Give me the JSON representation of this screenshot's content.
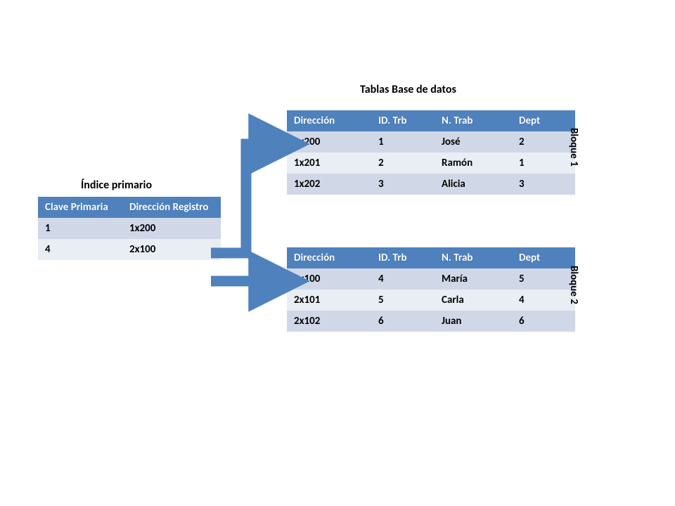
{
  "titles": {
    "tablas": "Tablas Base de datos",
    "indice": "Índice primario"
  },
  "index": {
    "headers": [
      "Clave Primaria",
      "Dirección Registro"
    ],
    "rows": [
      {
        "clave": "1",
        "dir": "1x200"
      },
      {
        "clave": "4",
        "dir": "2x100"
      }
    ]
  },
  "block_headers": [
    "Dirección",
    "ID. Trb",
    "N. Trab",
    "Dept"
  ],
  "block1": {
    "label": "Bloque 1",
    "rows": [
      {
        "dir": "1x200",
        "id": "1",
        "name": "José",
        "dept": "2"
      },
      {
        "dir": "1x201",
        "id": "2",
        "name": "Ramón",
        "dept": "1"
      },
      {
        "dir": "1x202",
        "id": "3",
        "name": "Alicia",
        "dept": "3"
      }
    ]
  },
  "block2": {
    "label": "Bloque 2",
    "rows": [
      {
        "dir": "2x100",
        "id": "4",
        "name": "María",
        "dept": "5"
      },
      {
        "dir": "2x101",
        "id": "5",
        "name": "Carla",
        "dept": "4"
      },
      {
        "dir": "2x102",
        "id": "6",
        "name": "Juan",
        "dept": "6"
      }
    ]
  }
}
